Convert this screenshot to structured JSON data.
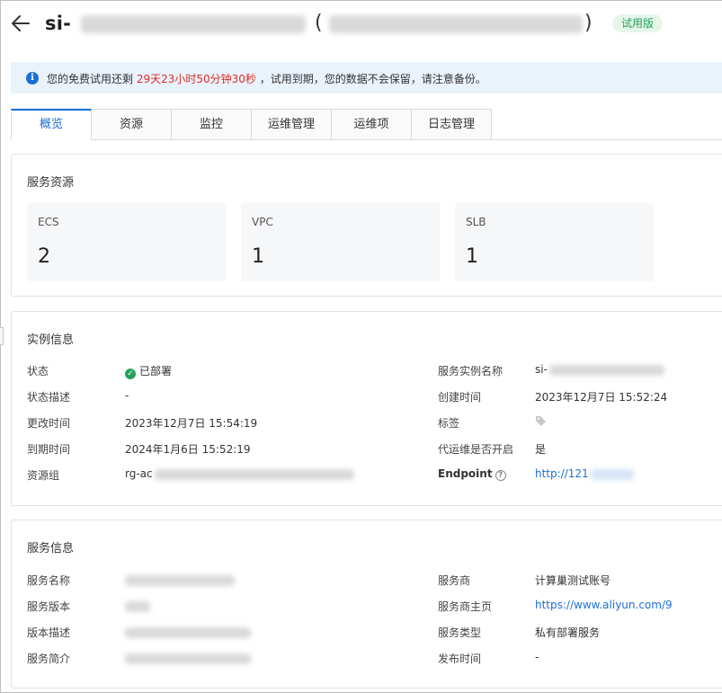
{
  "header": {
    "title_prefix": "si-",
    "paren_open": "(",
    "paren_close": ")",
    "badge": "试用版"
  },
  "notice": {
    "before": "您的免费试用还剩 ",
    "remaining": "29天23小时50分钟30秒",
    "after": " ，试用到期，您的数据不会保留，请注意备份。"
  },
  "tabs": [
    "概览",
    "资源",
    "监控",
    "运维管理",
    "运维项",
    "日志管理"
  ],
  "resources": {
    "title": "服务资源",
    "items": [
      {
        "label": "ECS",
        "value": "2"
      },
      {
        "label": "VPC",
        "value": "1"
      },
      {
        "label": "SLB",
        "value": "1"
      }
    ]
  },
  "instance": {
    "title": "实例信息",
    "status_label": "状态",
    "status_value": "已部署",
    "status_desc_label": "状态描述",
    "status_desc_value": "-",
    "modified_label": "更改时间",
    "modified_value": "2023年12月7日 15:54:19",
    "expire_label": "到期时间",
    "expire_value": "2024年1月6日 15:52:19",
    "rg_label": "资源组",
    "rg_value_prefix": "rg-ac",
    "name_label": "服务实例名称",
    "name_value_prefix": "si-",
    "created_label": "创建时间",
    "created_value": "2023年12月7日 15:52:24",
    "tags_label": "标签",
    "proxy_label": "代运维是否开启",
    "proxy_value": "是",
    "endpoint_label": "Endpoint",
    "endpoint_value_prefix": "http://121"
  },
  "service": {
    "title": "服务信息",
    "name_label": "服务名称",
    "version_label": "服务版本",
    "version_desc_label": "版本描述",
    "summary_label": "服务简介",
    "provider_label": "服务商",
    "provider_value": "计算巢测试账号",
    "homepage_label": "服务商主页",
    "homepage_value": "https://www.aliyun.com/9",
    "type_label": "服务类型",
    "type_value": "私有部署服务",
    "publish_label": "发布时间",
    "publish_value": "-"
  },
  "icons": {
    "back": "arrow-left-icon",
    "info": "info-icon",
    "status": "check-circle-icon",
    "tag": "tag-icon",
    "help": "question-circle-icon"
  },
  "colors": {
    "accent": "#1b6ed6",
    "notice_bg": "#eaf2fc",
    "alert": "#d93026",
    "success": "#23a35a"
  }
}
